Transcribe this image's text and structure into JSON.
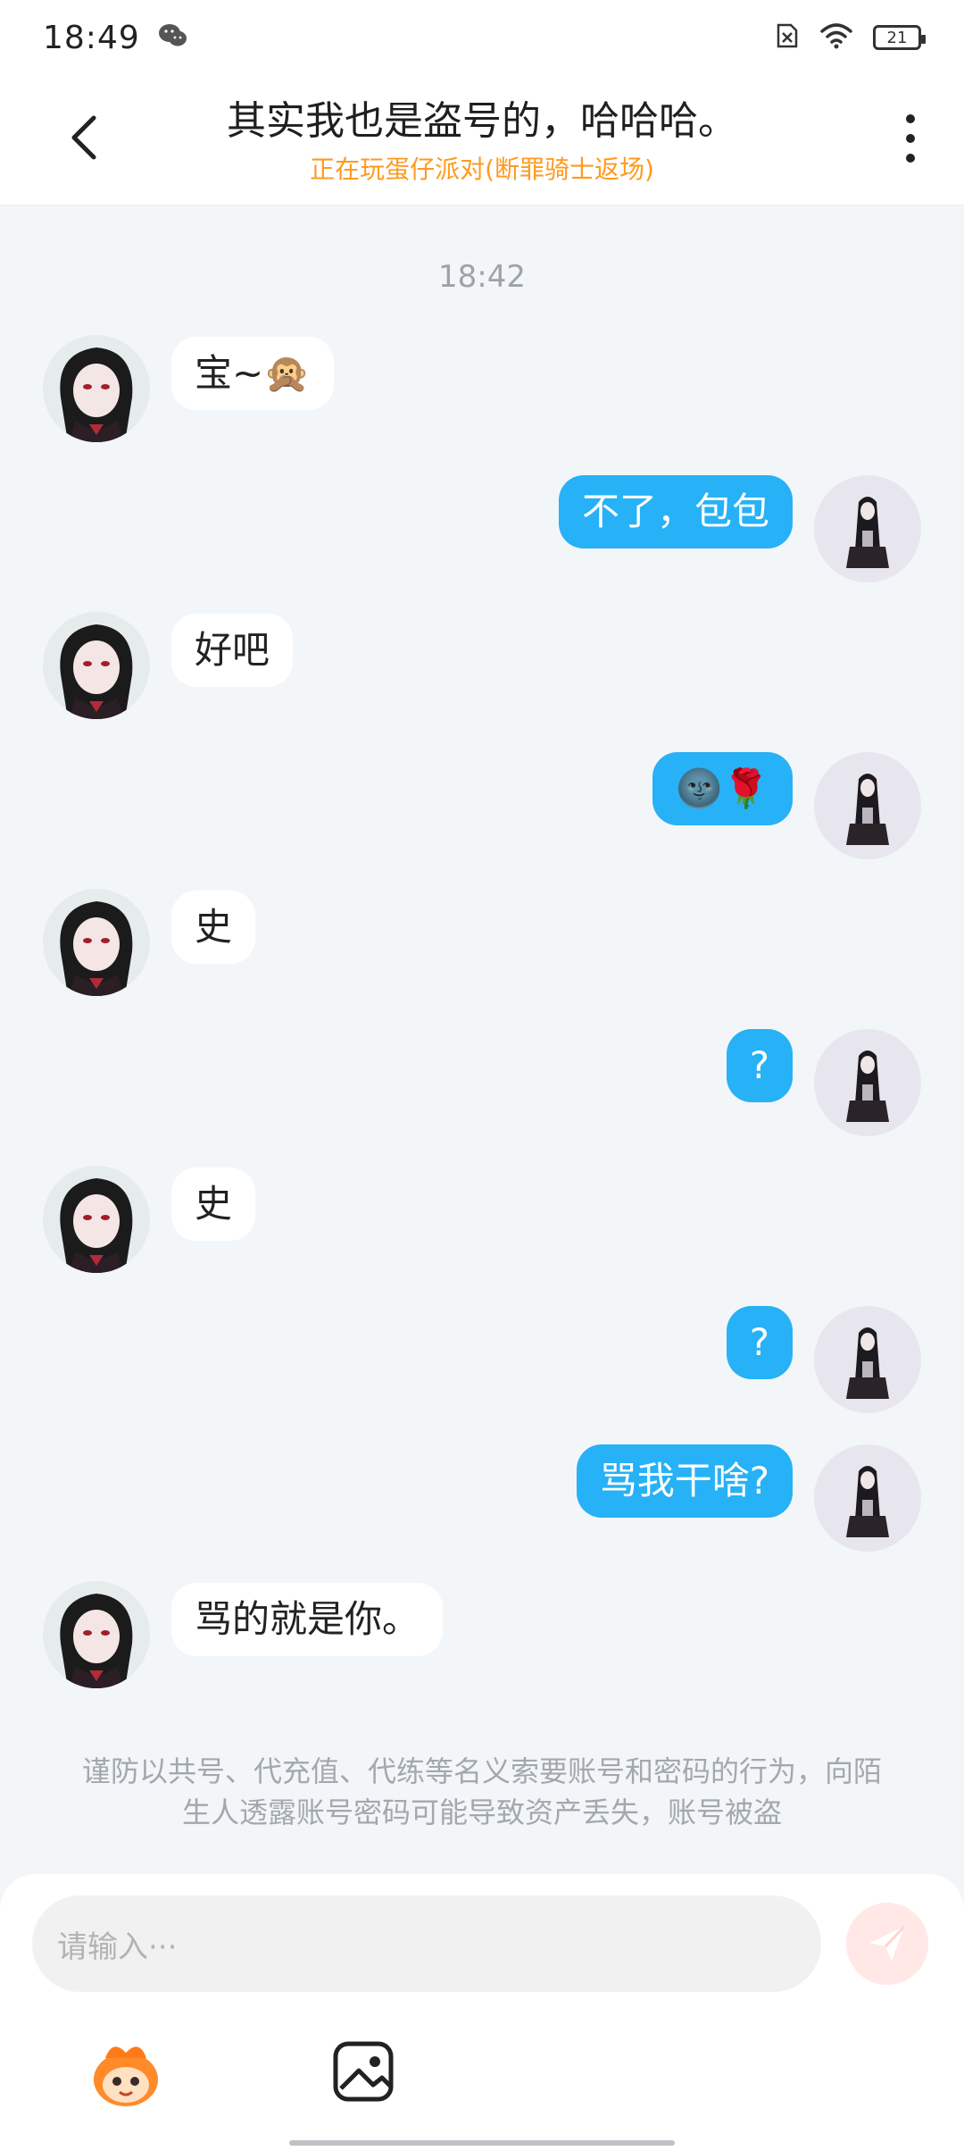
{
  "status": {
    "time": "18:49",
    "battery": "21"
  },
  "header": {
    "title": "其实我也是盗号的，哈哈哈。",
    "subtitle": "正在玩蛋仔派对(断罪骑士返场)"
  },
  "chat": {
    "timestamp": "18:42",
    "messages": [
      {
        "side": "left",
        "text": "宝~🙊"
      },
      {
        "side": "right",
        "text": "不了，包包"
      },
      {
        "side": "left",
        "text": "好吧"
      },
      {
        "side": "right",
        "text": "🌚🌹"
      },
      {
        "side": "left",
        "text": "史"
      },
      {
        "side": "right",
        "text": "?"
      },
      {
        "side": "left",
        "text": "史"
      },
      {
        "side": "right",
        "text": "?"
      },
      {
        "side": "right",
        "text": "骂我干啥?"
      },
      {
        "side": "left",
        "text": "骂的就是你。"
      }
    ],
    "notice": "谨防以共号、代充值、代练等名义索要账号和密码的行为，向陌生人透露账号密码可能导致资产丢失，账号被盗"
  },
  "input": {
    "placeholder": "请输入···"
  },
  "colors": {
    "accent_blue": "#27b1f6",
    "subtitle_orange": "#ff9a1f",
    "background": "#f3f6f9"
  }
}
